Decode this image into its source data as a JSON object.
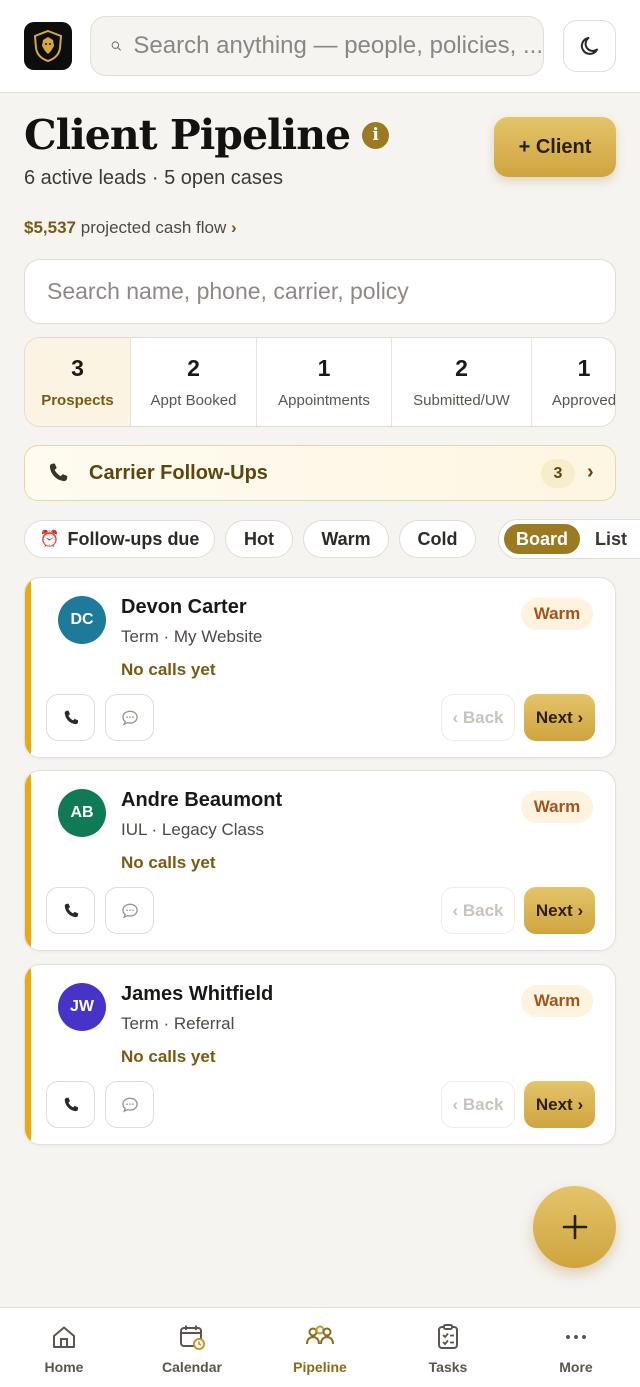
{
  "topbar": {
    "search_placeholder": "Search anything — people, policies, ..."
  },
  "header": {
    "title": "Client Pipeline",
    "info_badge": "i",
    "subtitle": "6 active leads · 5 open cases",
    "add_client_label": "+ Client",
    "cashflow_amount": "$5,537",
    "cashflow_label": "projected cash flow",
    "cashflow_chevron": "›"
  },
  "lead_search": {
    "placeholder": "Search name, phone, carrier, policy"
  },
  "stages": [
    {
      "count": "3",
      "label": "Prospects",
      "active": true
    },
    {
      "count": "2",
      "label": "Appt Booked",
      "active": false
    },
    {
      "count": "1",
      "label": "Appointments",
      "active": false
    },
    {
      "count": "2",
      "label": "Submitted/UW",
      "active": false
    },
    {
      "count": "1",
      "label": "Approved",
      "active": false
    }
  ],
  "carrier_followups": {
    "label": "Carrier Follow-Ups",
    "count": "3",
    "chevron": "›"
  },
  "filters": {
    "chips": [
      "Follow-ups due",
      "Hot",
      "Warm",
      "Cold"
    ],
    "view_active": "Board",
    "view_other": "List"
  },
  "leads": [
    {
      "initials": "DC",
      "name": "Devon Carter",
      "meta": "Term · My Website",
      "calls": "No calls yet",
      "temperature": "Warm",
      "avatar_color": "#1d7a9a"
    },
    {
      "initials": "AB",
      "name": "Andre Beaumont",
      "meta": "IUL · Legacy Class",
      "calls": "No calls yet",
      "temperature": "Warm",
      "avatar_color": "#0f7a55"
    },
    {
      "initials": "JW",
      "name": "James Whitfield",
      "meta": "Term · Referral",
      "calls": "No calls yet",
      "temperature": "Warm",
      "avatar_color": "#4634c8"
    }
  ],
  "card_actions": {
    "back_label": "‹ Back",
    "next_label": "Next ›"
  },
  "bottom_nav": [
    {
      "label": "Home",
      "icon": "home-icon",
      "active": false
    },
    {
      "label": "Calendar",
      "icon": "calendar-icon",
      "active": false
    },
    {
      "label": "Pipeline",
      "icon": "people-icon",
      "active": true
    },
    {
      "label": "Tasks",
      "icon": "clipboard-icon",
      "active": false
    },
    {
      "label": "More",
      "icon": "more-icon",
      "active": false
    }
  ],
  "colors": {
    "accent_gold": "#cfa43e",
    "accent_dark_gold": "#9c7a22",
    "card_stripe": "#e8a912",
    "warm_text": "#a5551b"
  }
}
